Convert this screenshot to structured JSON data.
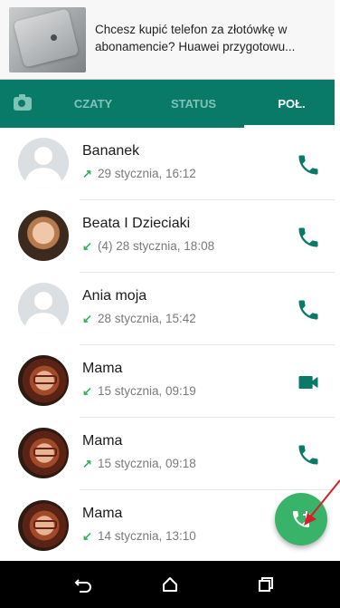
{
  "notification": {
    "text": "Chcesz kupić telefon za złotówkę w abonamencie? Huawei przygotowu..."
  },
  "tabs": [
    {
      "label": "",
      "icon": "camera-icon",
      "active": false
    },
    {
      "label": "CZATY",
      "active": false
    },
    {
      "label": "STATUS",
      "active": false
    },
    {
      "label": "POŁ.",
      "active": true
    }
  ],
  "calls": [
    {
      "name": "Bananek",
      "direction": "outgoing",
      "count": "",
      "time": "29 stycznia, 16:12",
      "type": "voice",
      "avatar": "default"
    },
    {
      "name": "Beata I Dzieciaki",
      "direction": "incoming",
      "count": "(4)",
      "time": "28 stycznia, 18:08",
      "type": "voice",
      "avatar": "photo"
    },
    {
      "name": "Ania moja",
      "direction": "incoming",
      "count": "",
      "time": "28 stycznia, 15:42",
      "type": "voice",
      "avatar": "default"
    },
    {
      "name": "Mama",
      "direction": "incoming",
      "count": "",
      "time": "15 stycznia, 09:19",
      "type": "video",
      "avatar": "photo"
    },
    {
      "name": "Mama",
      "direction": "outgoing",
      "count": "",
      "time": "15 stycznia, 09:18",
      "type": "voice",
      "avatar": "photo"
    },
    {
      "name": "Mama",
      "direction": "incoming",
      "count": "",
      "time": "14 stycznia, 13:10",
      "type": "voice",
      "avatar": "photo"
    }
  ],
  "fab": {
    "icon": "add-call-icon"
  },
  "navbar": {
    "icons": [
      "back-icon",
      "home-icon",
      "recents-icon"
    ]
  },
  "colors": {
    "primary": "#0a7a68",
    "accent": "#3ab36a",
    "call_icon": "#0a7a68",
    "arrow_annotation": "#d61f26"
  }
}
